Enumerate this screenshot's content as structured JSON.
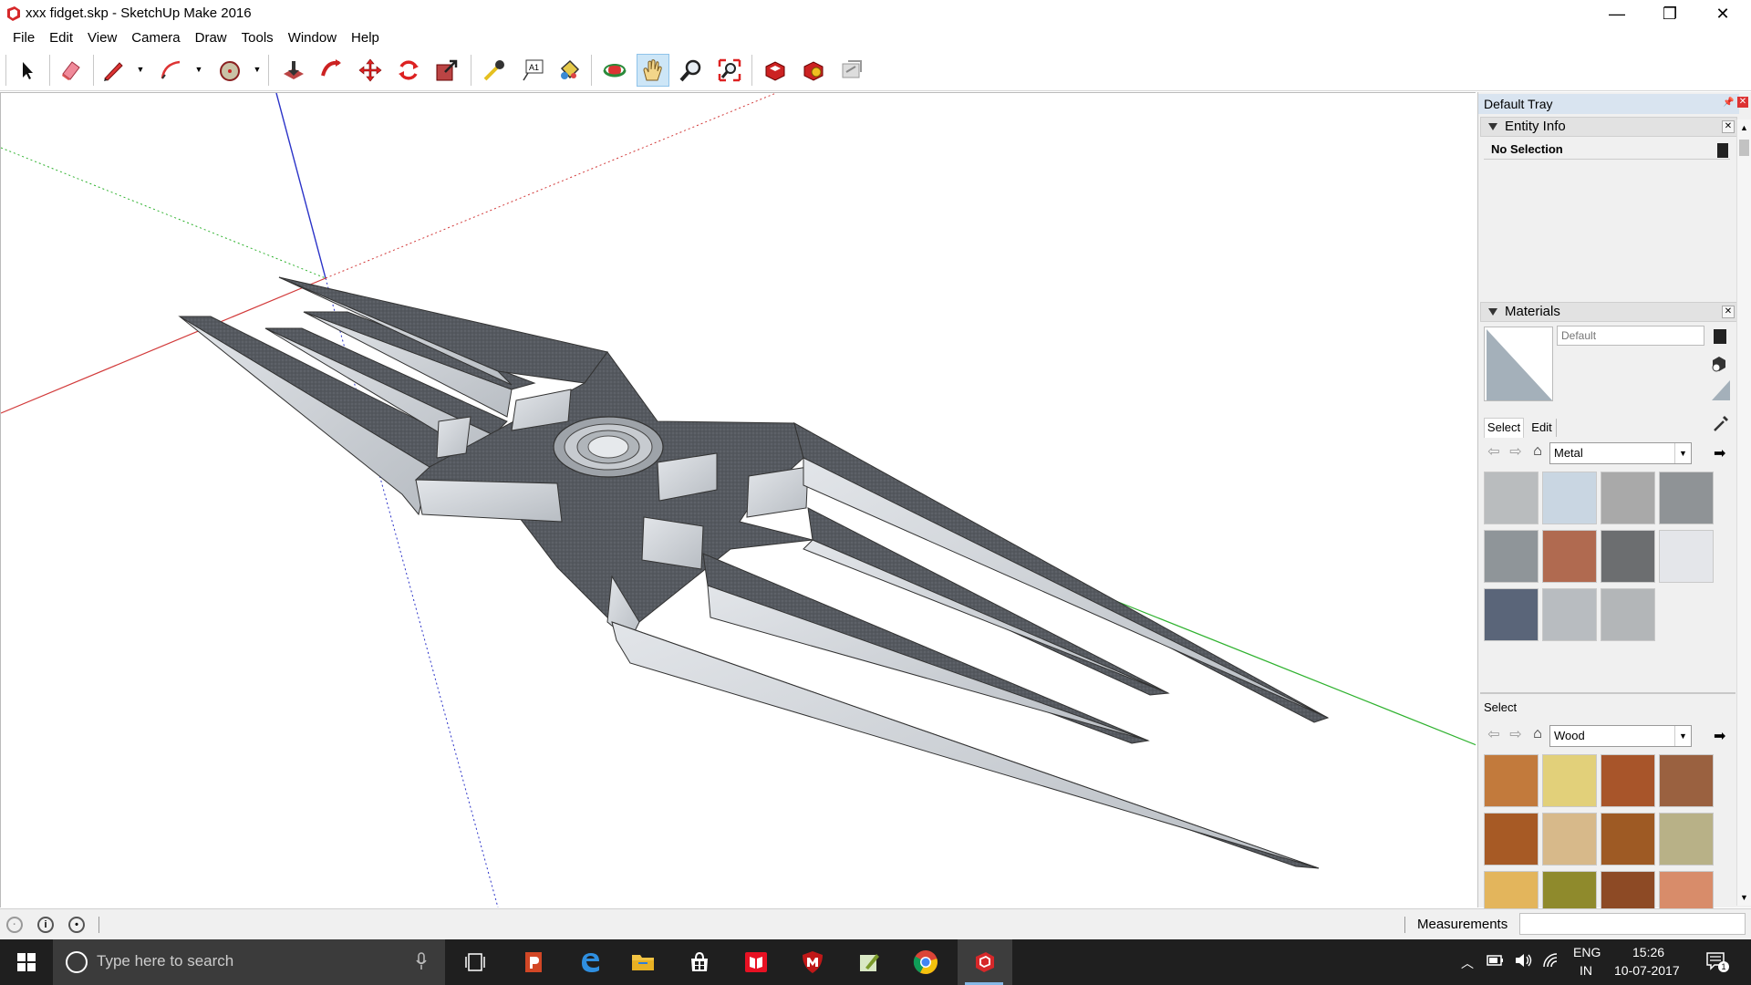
{
  "window": {
    "title": "xxx fidget.skp - SketchUp Make 2016",
    "minimize_label": "—",
    "restore_label": "❐",
    "close_label": "✕"
  },
  "menu": [
    "File",
    "Edit",
    "View",
    "Camera",
    "Draw",
    "Tools",
    "Window",
    "Help"
  ],
  "toolbar": {
    "tools": [
      "select-icon",
      "eraser-icon",
      "line-pencil-icon",
      "arc-icon",
      "circle-shape-icon",
      "push-pull-icon",
      "follow-me-icon",
      "move-icon",
      "rotate-icon",
      "scale-icon",
      "tape-measure-icon",
      "text-icon",
      "paint-bucket-icon",
      "orbit-icon",
      "pan-icon",
      "zoom-icon",
      "zoom-extents-icon",
      "3d-warehouse-icon",
      "extension-warehouse-icon",
      "layout-send-icon"
    ],
    "active_tool": "pan-icon"
  },
  "tray": {
    "title": "Default Tray",
    "entity_info": {
      "title": "Entity Info",
      "selection": "No Selection"
    },
    "materials": {
      "title": "Materials",
      "material_name_placeholder": "Default",
      "tabs": [
        "Select",
        "Edit"
      ],
      "active_tab": "Select",
      "library": "Metal",
      "metal_swatches": [
        "#b9bcbe",
        "#c9d6e2",
        "#a9a9a9",
        "#8f9396",
        "#8f9599",
        "#b06a50",
        "#6c6e70",
        "#e4e6ea",
        "#5a6579",
        "#b8bcc0",
        "#b3b6b8"
      ],
      "secondary_select_label": "Select",
      "secondary_library": "Wood",
      "wood_swatches": [
        "#c27a3c",
        "#e2d07a",
        "#a8552a",
        "#9a6140",
        "#a75a25",
        "#d7b98a",
        "#9e5a24",
        "#b8b187",
        "#e3b55c",
        "#8f8a2c",
        "#8d4a25",
        "#d88c6a"
      ]
    }
  },
  "status": {
    "measurements_label": "Measurements",
    "measurements_value": ""
  },
  "taskbar": {
    "search_placeholder": "Type here to search",
    "language": "ENG",
    "region": "IN",
    "time": "15:26",
    "date": "10-07-2017",
    "notification_count": "1"
  },
  "colors": {
    "accent_blue": "#86b8e6",
    "axis_red": "#d23a3a",
    "axis_green": "#2fb22f",
    "axis_blue": "#2b33c8",
    "model_dark": "#55595f",
    "model_light": "#d3d7dc"
  }
}
